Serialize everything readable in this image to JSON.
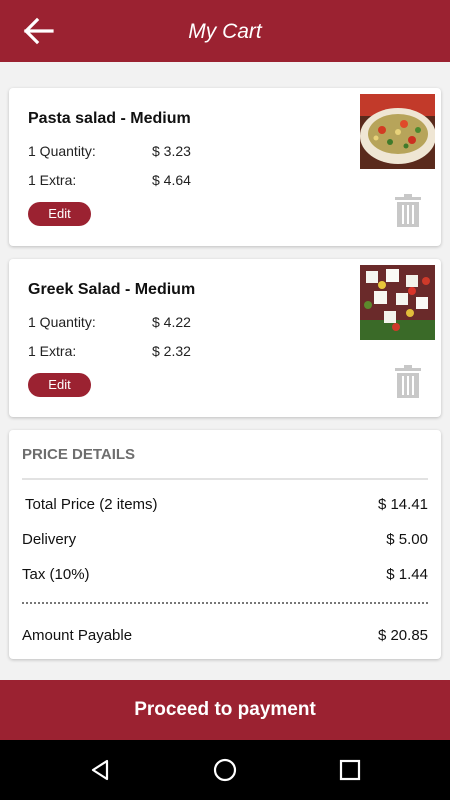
{
  "header": {
    "title": "My Cart",
    "back_icon": "arrow-left-icon"
  },
  "cart": {
    "items": [
      {
        "name": "Pasta salad - Medium",
        "quantity_label": "1 Quantity:",
        "quantity_price": "$ 3.23",
        "extra_label": "1 Extra:",
        "extra_price": "$ 4.64",
        "edit_label": "Edit",
        "image": "pasta-salad-photo"
      },
      {
        "name": "Greek Salad - Medium",
        "quantity_label": "1 Quantity:",
        "quantity_price": "$ 4.22",
        "extra_label": "1 Extra:",
        "extra_price": "$ 2.32",
        "edit_label": "Edit",
        "image": "greek-salad-photo"
      }
    ]
  },
  "price_details": {
    "title": "PRICE DETAILS",
    "rows": [
      {
        "label": "Total Price (2 items)",
        "value": "$ 14.41"
      },
      {
        "label": "Delivery",
        "value": "$ 5.00"
      },
      {
        "label": "Tax (10%)",
        "value": "$ 1.44"
      }
    ],
    "payable_label": "Amount Payable",
    "payable_value": "$ 20.85"
  },
  "footer": {
    "proceed_label": "Proceed to payment"
  },
  "colors": {
    "brand": "#9b2231",
    "background": "#f2f2f2",
    "trash": "#c8c8c8"
  }
}
